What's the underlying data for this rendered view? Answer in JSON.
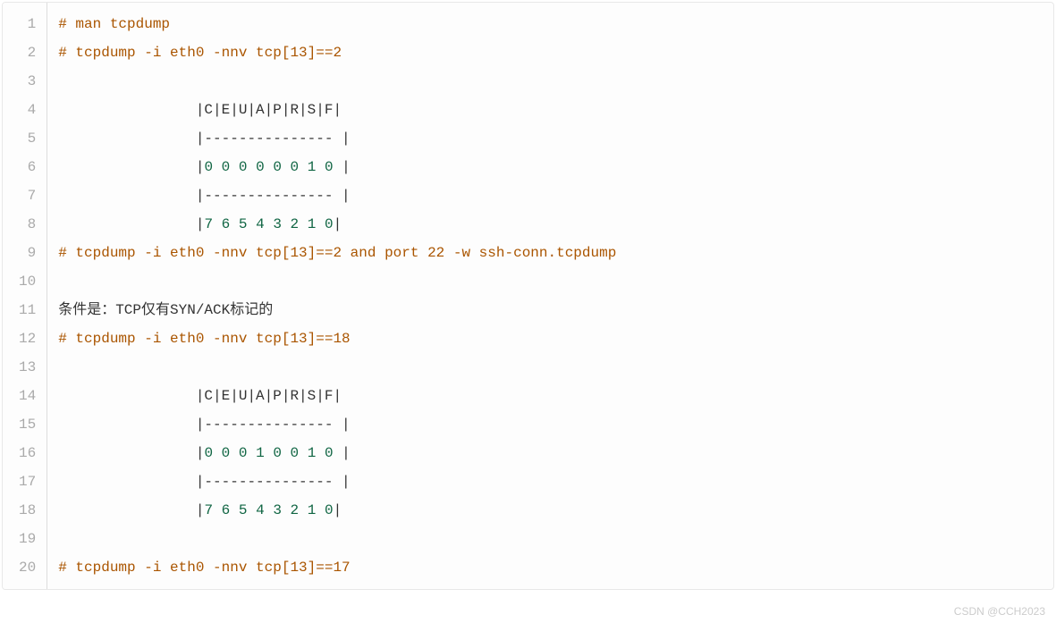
{
  "lineCount": 20,
  "watermark": "CSDN @CCH2023",
  "lines": [
    {
      "tokens": [
        {
          "cls": "comment",
          "text": "# man tcpdump"
        }
      ]
    },
    {
      "tokens": [
        {
          "cls": "comment",
          "text": "# tcpdump -i eth0 -nnv tcp[13]==2"
        }
      ]
    },
    {
      "tokens": []
    },
    {
      "tokens": [
        {
          "cls": "plain",
          "text": "                |C|E|U|A|P|R|S|F|"
        }
      ]
    },
    {
      "tokens": [
        {
          "cls": "plain",
          "text": "                |--------------- |"
        }
      ]
    },
    {
      "tokens": [
        {
          "cls": "plain",
          "text": "                |"
        },
        {
          "cls": "number",
          "text": "0"
        },
        {
          "cls": "plain",
          "text": " "
        },
        {
          "cls": "number",
          "text": "0"
        },
        {
          "cls": "plain",
          "text": " "
        },
        {
          "cls": "number",
          "text": "0"
        },
        {
          "cls": "plain",
          "text": " "
        },
        {
          "cls": "number",
          "text": "0"
        },
        {
          "cls": "plain",
          "text": " "
        },
        {
          "cls": "number",
          "text": "0"
        },
        {
          "cls": "plain",
          "text": " "
        },
        {
          "cls": "number",
          "text": "0"
        },
        {
          "cls": "plain",
          "text": " "
        },
        {
          "cls": "number",
          "text": "1"
        },
        {
          "cls": "plain",
          "text": " "
        },
        {
          "cls": "number",
          "text": "0"
        },
        {
          "cls": "plain",
          "text": " |"
        }
      ]
    },
    {
      "tokens": [
        {
          "cls": "plain",
          "text": "                |--------------- |"
        }
      ]
    },
    {
      "tokens": [
        {
          "cls": "plain",
          "text": "                |"
        },
        {
          "cls": "number",
          "text": "7"
        },
        {
          "cls": "plain",
          "text": " "
        },
        {
          "cls": "number",
          "text": "6"
        },
        {
          "cls": "plain",
          "text": " "
        },
        {
          "cls": "number",
          "text": "5"
        },
        {
          "cls": "plain",
          "text": " "
        },
        {
          "cls": "number",
          "text": "4"
        },
        {
          "cls": "plain",
          "text": " "
        },
        {
          "cls": "number",
          "text": "3"
        },
        {
          "cls": "plain",
          "text": " "
        },
        {
          "cls": "number",
          "text": "2"
        },
        {
          "cls": "plain",
          "text": " "
        },
        {
          "cls": "number",
          "text": "1"
        },
        {
          "cls": "plain",
          "text": " "
        },
        {
          "cls": "number",
          "text": "0"
        },
        {
          "cls": "plain",
          "text": "|"
        }
      ]
    },
    {
      "tokens": [
        {
          "cls": "comment",
          "text": "# tcpdump -i eth0 -nnv tcp[13]==2 and port 22 -w ssh-conn.tcpdump"
        }
      ]
    },
    {
      "tokens": []
    },
    {
      "tokens": [
        {
          "cls": "plain",
          "text": "条件是：TCP仅有SYN/ACK标记的"
        }
      ]
    },
    {
      "tokens": [
        {
          "cls": "comment",
          "text": "# tcpdump -i eth0 -nnv tcp[13]==18"
        }
      ]
    },
    {
      "tokens": []
    },
    {
      "tokens": [
        {
          "cls": "plain",
          "text": "                |C|E|U|A|P|R|S|F|"
        }
      ]
    },
    {
      "tokens": [
        {
          "cls": "plain",
          "text": "                |--------------- |"
        }
      ]
    },
    {
      "tokens": [
        {
          "cls": "plain",
          "text": "                |"
        },
        {
          "cls": "number",
          "text": "0"
        },
        {
          "cls": "plain",
          "text": " "
        },
        {
          "cls": "number",
          "text": "0"
        },
        {
          "cls": "plain",
          "text": " "
        },
        {
          "cls": "number",
          "text": "0"
        },
        {
          "cls": "plain",
          "text": " "
        },
        {
          "cls": "number",
          "text": "1"
        },
        {
          "cls": "plain",
          "text": " "
        },
        {
          "cls": "number",
          "text": "0"
        },
        {
          "cls": "plain",
          "text": " "
        },
        {
          "cls": "number",
          "text": "0"
        },
        {
          "cls": "plain",
          "text": " "
        },
        {
          "cls": "number",
          "text": "1"
        },
        {
          "cls": "plain",
          "text": " "
        },
        {
          "cls": "number",
          "text": "0"
        },
        {
          "cls": "plain",
          "text": " |"
        }
      ]
    },
    {
      "tokens": [
        {
          "cls": "plain",
          "text": "                |--------------- |"
        }
      ]
    },
    {
      "tokens": [
        {
          "cls": "plain",
          "text": "                |"
        },
        {
          "cls": "number",
          "text": "7"
        },
        {
          "cls": "plain",
          "text": " "
        },
        {
          "cls": "number",
          "text": "6"
        },
        {
          "cls": "plain",
          "text": " "
        },
        {
          "cls": "number",
          "text": "5"
        },
        {
          "cls": "plain",
          "text": " "
        },
        {
          "cls": "number",
          "text": "4"
        },
        {
          "cls": "plain",
          "text": " "
        },
        {
          "cls": "number",
          "text": "3"
        },
        {
          "cls": "plain",
          "text": " "
        },
        {
          "cls": "number",
          "text": "2"
        },
        {
          "cls": "plain",
          "text": " "
        },
        {
          "cls": "number",
          "text": "1"
        },
        {
          "cls": "plain",
          "text": " "
        },
        {
          "cls": "number",
          "text": "0"
        },
        {
          "cls": "plain",
          "text": "|"
        }
      ]
    },
    {
      "tokens": []
    },
    {
      "tokens": [
        {
          "cls": "comment",
          "text": "# tcpdump -i eth0 -nnv tcp[13]==17"
        }
      ]
    }
  ]
}
